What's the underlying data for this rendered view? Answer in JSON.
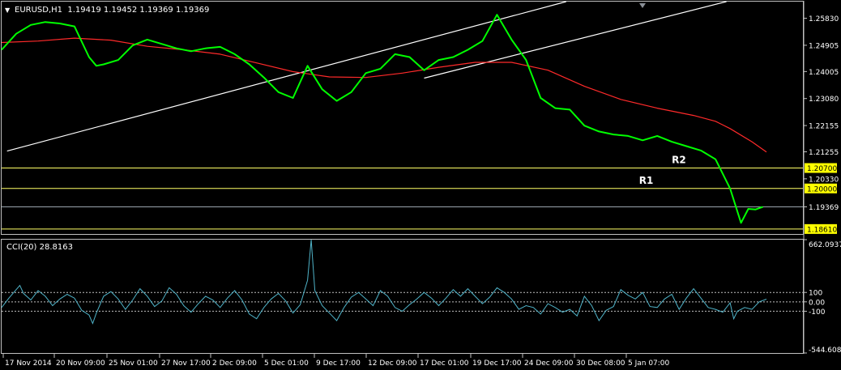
{
  "colors": {
    "background": "#000000",
    "frame": "#c0c0c0",
    "price": "#00ff00",
    "ma": "#ff2a2a",
    "channel": "#ffffff",
    "level": "#ffff66",
    "current_line": "#9aa3ad",
    "cci": "#4fb3c8",
    "label_bg": "#ffff00",
    "text": "#ffffff"
  },
  "header": {
    "arrow": "▼",
    "symbol_info": "EURUSD,H1  1.19419 1.19452 1.19369 1.19369"
  },
  "chart_data": [
    {
      "type": "line",
      "title": "EURUSD,H1  1.19419 1.19452 1.19369 1.19369",
      "y_ticks": [
        "1.25830",
        "1.24905",
        "1.24005",
        "1.23080",
        "1.22155",
        "1.21255",
        "1.20330",
        "1.19369",
        "1.18610"
      ],
      "ylim": [
        1.1844,
        1.264
      ],
      "x_ticks": [
        "17 Nov 2014",
        "20 Nov 09:00",
        "25 Nov 01:00",
        "27 Nov 17:00",
        "2 Dec 09:00",
        "5 Dec 01:00",
        "9 Dec 17:00",
        "12 Dec 09:00",
        "17 Dec 01:00",
        "19 Dec 17:00",
        "24 Dec 09:00",
        "30 Dec 08:00",
        "5 Jan 07:00"
      ],
      "xlim": [
        0,
        220
      ],
      "series": [
        {
          "style": "price",
          "x": [
            0,
            4,
            8,
            12,
            16,
            20,
            24,
            26,
            28,
            32,
            36,
            40,
            44,
            48,
            52,
            56,
            60,
            64,
            68,
            72,
            76,
            80,
            84,
            88,
            92,
            96,
            100,
            104,
            108,
            112,
            116,
            120,
            124,
            128,
            132,
            136,
            140,
            144,
            148,
            152,
            156,
            160,
            164,
            168,
            172,
            176,
            180,
            184,
            188,
            192,
            196,
            200,
            203,
            205,
            207,
            209
          ],
          "y": [
            1.2475,
            1.253,
            1.256,
            1.257,
            1.2565,
            1.2555,
            1.245,
            1.242,
            1.2425,
            1.244,
            1.249,
            1.251,
            1.2495,
            1.248,
            1.247,
            1.248,
            1.2485,
            1.246,
            1.2425,
            1.238,
            1.233,
            1.231,
            1.242,
            1.234,
            1.23,
            1.233,
            1.2395,
            1.241,
            1.246,
            1.245,
            1.2405,
            1.244,
            1.245,
            1.2475,
            1.2505,
            1.2595,
            1.251,
            1.244,
            1.231,
            1.2275,
            1.227,
            1.2215,
            1.2195,
            1.2185,
            1.218,
            1.2165,
            1.218,
            1.216,
            1.2145,
            1.213,
            1.21,
            1.2,
            1.1882,
            1.193,
            1.1928,
            1.1937
          ]
        },
        {
          "style": "ma",
          "x": [
            0,
            10,
            20,
            30,
            40,
            50,
            60,
            70,
            80,
            90,
            100,
            110,
            120,
            130,
            140,
            150,
            160,
            170,
            180,
            190,
            196,
            200,
            206,
            210
          ],
          "y": [
            1.25,
            1.2505,
            1.2515,
            1.2508,
            1.2487,
            1.2475,
            1.246,
            1.243,
            1.24,
            1.2382,
            1.238,
            1.2395,
            1.2415,
            1.2432,
            1.2432,
            1.2405,
            1.235,
            1.2305,
            1.2275,
            1.225,
            1.223,
            1.2205,
            1.216,
            1.2125
          ]
        },
        {
          "style": "channel",
          "x": [
            1.5,
            155
          ],
          "y": [
            1.2128,
            1.264
          ]
        },
        {
          "style": "channel",
          "x": [
            116,
            199
          ],
          "y": [
            1.2378,
            1.264
          ]
        }
      ],
      "levels": [
        {
          "name": "R2",
          "value": 1.207,
          "price_label": "1.20700"
        },
        {
          "name": "R1",
          "value": 1.2,
          "price_label": "1.20000"
        },
        {
          "name": "",
          "value": 1.1861,
          "price_label": "1.18610"
        }
      ],
      "current_price": {
        "value": 1.19369,
        "label": "1.19369"
      },
      "grid": false,
      "legend": "none"
    },
    {
      "type": "line",
      "title": "CCI(20) 28.8163",
      "y_ticks": [
        "662.0937",
        "100",
        "0.00",
        "-100",
        "-544.6083"
      ],
      "ylim": [
        -544.6083,
        662.0937
      ],
      "levels": [
        100,
        0,
        -100
      ],
      "xlim": [
        0,
        220
      ],
      "series": [
        {
          "name": "CCI(20)",
          "x": [
            0,
            2,
            4,
            5,
            6,
            8,
            10,
            12,
            14,
            16,
            18,
            20,
            22,
            24,
            25,
            26,
            28,
            30,
            32,
            34,
            36,
            38,
            40,
            42,
            44,
            46,
            48,
            50,
            52,
            54,
            56,
            58,
            60,
            62,
            64,
            66,
            68,
            70,
            72,
            74,
            76,
            78,
            80,
            82,
            84,
            85,
            86,
            88,
            90,
            92,
            94,
            96,
            98,
            100,
            102,
            104,
            106,
            108,
            110,
            112,
            114,
            116,
            118,
            120,
            122,
            124,
            126,
            128,
            130,
            132,
            134,
            136,
            138,
            140,
            142,
            144,
            146,
            148,
            150,
            152,
            154,
            156,
            158,
            160,
            162,
            164,
            166,
            168,
            170,
            172,
            174,
            176,
            178,
            180,
            182,
            184,
            186,
            188,
            190,
            192,
            194,
            196,
            198,
            200,
            201,
            202,
            204,
            206,
            208,
            210
          ],
          "y": [
            -60,
            40,
            130,
            175,
            90,
            20,
            120,
            60,
            -40,
            30,
            80,
            40,
            -90,
            -140,
            -230,
            -120,
            60,
            110,
            30,
            -80,
            20,
            140,
            60,
            -50,
            10,
            150,
            80,
            -40,
            -110,
            -20,
            60,
            20,
            -60,
            40,
            120,
            20,
            -130,
            -180,
            -60,
            30,
            90,
            10,
            -120,
            -30,
            230,
            660,
            120,
            -40,
            -120,
            -200,
            -60,
            50,
            100,
            30,
            -40,
            120,
            60,
            -60,
            -100,
            -30,
            30,
            100,
            40,
            -40,
            40,
            130,
            60,
            140,
            60,
            -20,
            50,
            150,
            100,
            30,
            -80,
            -40,
            -60,
            -130,
            -20,
            -60,
            -110,
            -80,
            -150,
            60,
            -40,
            -200,
            -90,
            -50,
            130,
            70,
            30,
            100,
            -50,
            -60,
            30,
            80,
            -80,
            40,
            140,
            40,
            -60,
            -80,
            -110,
            -10,
            -180,
            -100,
            -60,
            -80,
            0,
            28.8163
          ]
        }
      ],
      "grid": false,
      "legend": "none"
    }
  ]
}
